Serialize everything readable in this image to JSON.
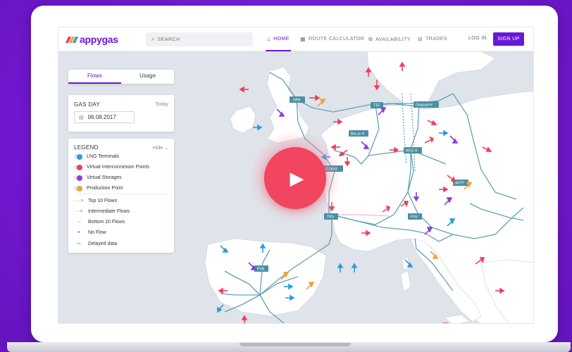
{
  "nav": {
    "logo_text": "appygas",
    "search_placeholder": "SEARCH",
    "home": "HOME",
    "route_calculator": "ROUTE CALCULATOR",
    "availability": "AVAILABILITY",
    "trades": "TRADES",
    "login": "LOG IN",
    "signup": "SIGN UP"
  },
  "tabs": {
    "flows": "Flows",
    "usage": "Usage"
  },
  "gasday": {
    "title": "GAS DAY",
    "today": "Today",
    "date": "06.08.2017"
  },
  "legend": {
    "title": "LEGEND",
    "hide": "Hide",
    "toggles": [
      {
        "label": "LNG Terminals",
        "color": "#2d9be0"
      },
      {
        "label": "Virtual Interconnexion Points",
        "color": "#ef3e5c"
      },
      {
        "label": "Virtual Storages",
        "color": "#8a3fd8"
      },
      {
        "label": "Production Point",
        "color": "#f2a23a"
      }
    ],
    "flows": [
      {
        "label": "Top 10 Flows",
        "icon": "····>"
      },
      {
        "label": "Intermediate Flows",
        "icon": "···>"
      },
      {
        "label": "Bottom 10 Flows",
        "icon": "→"
      },
      {
        "label": "No Flow",
        "icon": "≡"
      },
      {
        "label": "Delayed data",
        "icon": "⇨"
      }
    ]
  },
  "hubs": [
    "NPB",
    "TTF",
    "Gaspool H",
    "BeLux H",
    "NCG H",
    "G.Nord",
    "AVTP",
    "TRS",
    "PSV",
    "PVB"
  ],
  "colors": {
    "brand": "#6a18d8",
    "lng": "#2d9be0",
    "vip": "#ef3e5c",
    "storage": "#8a3fd8",
    "production": "#f2a23a",
    "pipeline": "#5fa3b3",
    "hub": "#4b8fa3",
    "land": "#ffffff",
    "sea": "#dfe3ea"
  }
}
